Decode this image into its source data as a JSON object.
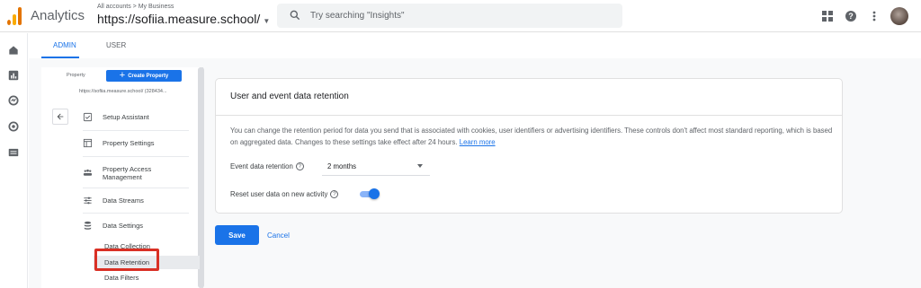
{
  "header": {
    "app_name": "Analytics",
    "breadcrumb": "All accounts > My Business",
    "account_name": "https://sofiia.measure.school/",
    "search_placeholder": "Try searching \"Insights\""
  },
  "tabs": [
    {
      "label": "ADMIN",
      "active": true
    },
    {
      "label": "USER",
      "active": false
    }
  ],
  "sidebar": {
    "property_label": "Property",
    "create_button": "Create Property",
    "property_url": "https://sofiia.measure.school/ (328434...",
    "items": [
      {
        "label": "Setup Assistant",
        "icon": "checkbox-icon"
      },
      {
        "label": "Property Settings",
        "icon": "settings-page-icon"
      },
      {
        "label": "Property Access Management",
        "icon": "people-icon"
      },
      {
        "label": "Data Streams",
        "icon": "streams-icon"
      },
      {
        "label": "Data Settings",
        "icon": "database-icon"
      }
    ],
    "sub_items": [
      {
        "label": "Data Collection"
      },
      {
        "label": "Data Retention",
        "selected": true
      },
      {
        "label": "Data Filters"
      }
    ]
  },
  "card": {
    "title": "User and event data retention",
    "description": "You can change the retention period for data you send that is associated with cookies, user identifiers or advertising identifiers. These controls don't affect most standard reporting, which is based on aggregated data. Changes to these settings take effect after 24 hours.",
    "learn_more": "Learn more",
    "event_retention_label": "Event data retention",
    "event_retention_value": "2 months",
    "reset_label": "Reset user data on new activity",
    "reset_enabled": true
  },
  "actions": {
    "save": "Save",
    "cancel": "Cancel"
  },
  "colors": {
    "accent": "#1a73e8",
    "highlight_box": "#d93025"
  }
}
